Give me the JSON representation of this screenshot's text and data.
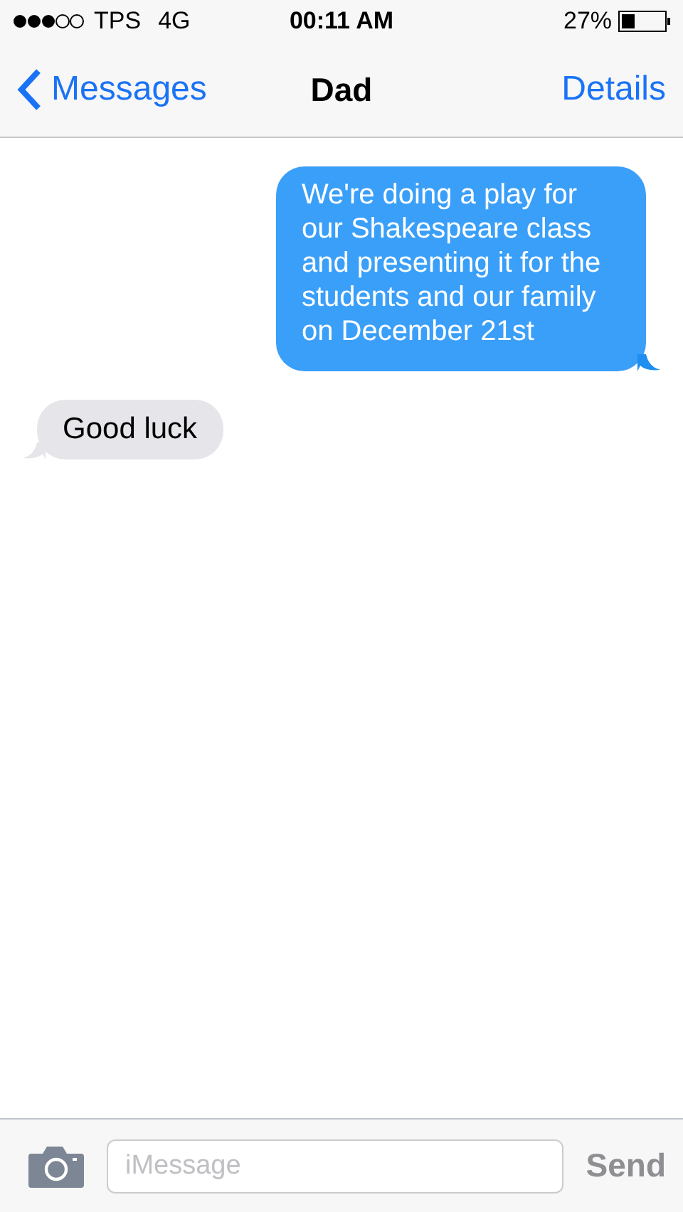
{
  "status_bar": {
    "carrier": "TPS",
    "network": "4G",
    "time": "00:11 AM",
    "battery": "27%"
  },
  "nav_bar": {
    "back": "Messages",
    "title": "Dad",
    "action": "Details"
  },
  "messages": [
    {
      "kind": "sent",
      "text": "We're doing a play for our Shakespeare class and presenting it for the students and our family on December 21st"
    },
    {
      "kind": "received",
      "text": "Good luck"
    }
  ],
  "composer": {
    "placeholder": "iMessage",
    "send": "Send",
    "send_disabled": true
  }
}
